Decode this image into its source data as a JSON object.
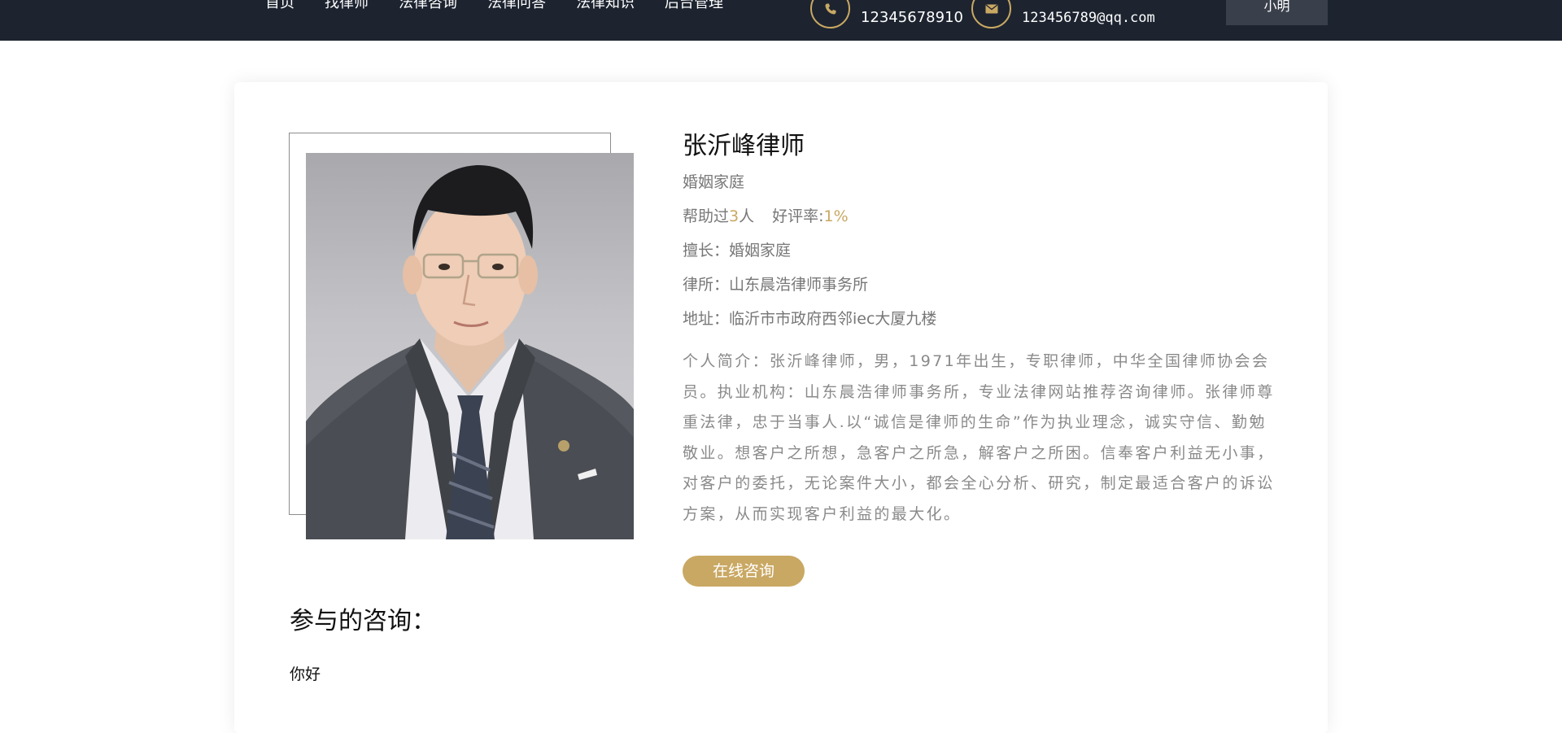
{
  "header": {
    "nav": [
      "首页",
      "找律师",
      "法律咨询",
      "法律问答",
      "法律知识",
      "后台管理"
    ],
    "phone": "12345678910",
    "email": "123456789@qq.com",
    "user_name": "小明",
    "phone_icon": "phone-icon",
    "email_icon": "mail-icon",
    "accent_color": "#c9a863",
    "bar_color": "#1d2430"
  },
  "lawyer": {
    "name": "张沂峰律师",
    "category": "婚姻家庭",
    "helped_prefix": "帮助过",
    "helped_count": "3",
    "helped_suffix": "人",
    "rating_label": "好评率:",
    "rating_value": "1%",
    "specialty": "擅长：婚姻家庭",
    "firm": "律所：山东晨浩律师事务所",
    "address": "地址：临沂市市政府西邻iec大厦九楼",
    "intro": "个人简介：张沂峰律师，男，1971年出生，专职律师，中华全国律师协会会员。执业机构：山东晨浩律师事务所，专业法律网站推荐咨询律师。张律师尊重法律，忠于当事人.以“诚信是律师的生命”作为执业理念，诚实守信、勤勉敬业。想客户之所想，急客户之所急，解客户之所困。信奉客户利益无小事，对客户的委托，无论案件大小，都会全心分析、研究，制定最适合客户的诉讼方案，从而实现客户利益的最大化。",
    "consult_button": "在线咨询"
  },
  "consultations": {
    "title": "参与的咨询：",
    "items": [
      "你好"
    ]
  }
}
